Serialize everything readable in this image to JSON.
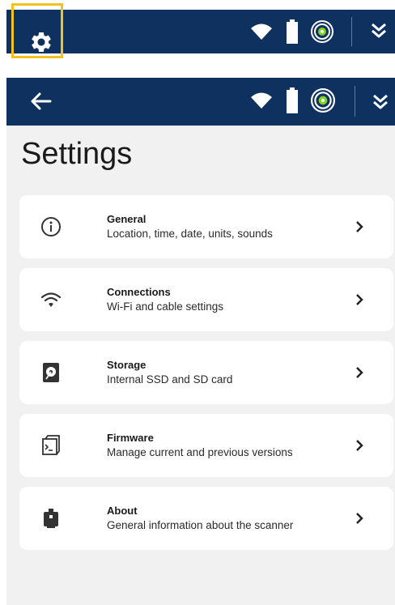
{
  "screen": {
    "title": "Settings"
  },
  "topbar": {
    "icons": [
      "gear-icon",
      "wifi-icon",
      "battery-icon",
      "gps-target-icon",
      "double-chevron-down-icon"
    ]
  },
  "subbar": {
    "icons": [
      "back-arrow-icon",
      "wifi-icon",
      "battery-icon",
      "gps-target-icon",
      "double-chevron-down-icon"
    ]
  },
  "settings_items": [
    {
      "title": "General",
      "subtitle": "Location, time, date, units, sounds",
      "icon": "info-icon"
    },
    {
      "title": "Connections",
      "subtitle": "Wi-Fi and cable settings",
      "icon": "wifi-icon"
    },
    {
      "title": "Storage",
      "subtitle": "Internal SSD and SD card",
      "icon": "storage-icon"
    },
    {
      "title": "Firmware",
      "subtitle": "Manage current and previous versions",
      "icon": "firmware-icon"
    },
    {
      "title": "About",
      "subtitle": "General information about the scanner",
      "icon": "scanner-icon"
    }
  ],
  "colors": {
    "bar": "#0f3160",
    "highlight": "#f3c21c",
    "background": "#f1f1f2",
    "card": "#ffffff",
    "gps_accent": "#7fd321"
  }
}
